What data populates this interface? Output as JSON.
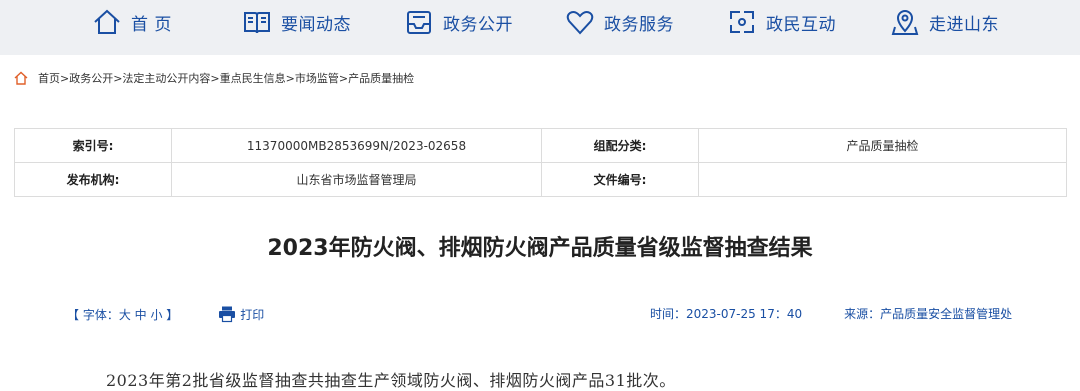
{
  "nav": {
    "items": [
      {
        "label": "首 页",
        "icon": "home-icon"
      },
      {
        "label": "要闻动态",
        "icon": "news-book-icon"
      },
      {
        "label": "政务公开",
        "icon": "inbox-icon"
      },
      {
        "label": "政务服务",
        "icon": "heart-icon"
      },
      {
        "label": "政民互动",
        "icon": "interact-icon"
      },
      {
        "label": "走进山东",
        "icon": "map-pin-icon"
      }
    ],
    "color": "#1a4fa3"
  },
  "breadcrumb": {
    "icon": "home-icon",
    "path": "首页>政务公开>法定主动公开内容>重点民生信息>市场监管>产品质量抽检"
  },
  "meta": {
    "index_label": "索引号:",
    "index_value": "11370000MB2853699N/2023-02658",
    "category_label": "组配分类:",
    "category_value": "产品质量抽检",
    "org_label": "发布机构:",
    "org_value": "山东省市场监督管理局",
    "doc_no_label": "文件编号:",
    "doc_no_value": ""
  },
  "article": {
    "title": "2023年防火阀、排烟防火阀产品质量省级监督抽查结果",
    "font_control": "【 字体：大 中 小 】",
    "print_label": "打印",
    "time": "时间：2023-07-25 17：40",
    "source": "来源：产品质量安全监督管理处",
    "body": "2023年第2批省级监督抽查共抽查生产领域防火阀、排烟防火阀产品31批次。"
  }
}
